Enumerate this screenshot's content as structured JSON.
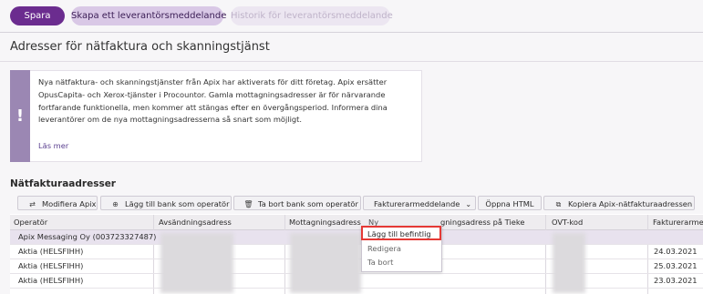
{
  "toolbar": {
    "save_label": "Spara",
    "create_message_label": "Skapa ett leverantörsmeddelande",
    "history_label": "Historik för leverantörsmeddelande"
  },
  "page": {
    "title": "Adresser för nätfaktura och skanningstjänst"
  },
  "notice": {
    "icon": "exclamation-icon",
    "text": "Nya nätfaktura- och skanningstjänster från Apix har aktiverats för ditt företag. Apix ersätter OpusCapita- och Xerox-tjänster i Procountor. Gamla mottagningsadresser är för närvarande fortfarande funktionella, men kommer att stängas efter en övergångsperiod. Informera dina leverantörer om de nya mottagningsadresserna så snart som möjligt.",
    "link_label": "Läs mer"
  },
  "section": {
    "title": "Nätfakturaadresser"
  },
  "actions": {
    "modify_apix": "Modifiera Apix",
    "add_bank": "Lägg till bank som operatör",
    "remove_bank": "Ta bort bank som operatör",
    "invoicer_message": "Fakturerarmeddelande",
    "open_html": "Öppna HTML",
    "copy_apix": "Kopiera Apix-nätfakturaadressen"
  },
  "table": {
    "headers": {
      "operator": "Operatör",
      "sender_address": "Avsändningsadress",
      "receiver_address": "Mottagningsadress",
      "tieke_address": "gningsadress på Tieke",
      "ovt": "OVT-kod",
      "invoicer": "Fakturerarme"
    },
    "rows": [
      {
        "operator": "Apix Messaging Oy (003723327487)",
        "date": ""
      },
      {
        "operator": "Aktia (HELSFIHH)",
        "date": "24.03.2021"
      },
      {
        "operator": "Aktia (HELSFIHH)",
        "date": "25.03.2021"
      },
      {
        "operator": "Aktia (HELSFIHH)",
        "date": "23.03.2021"
      }
    ]
  },
  "dropdown": {
    "items": [
      "Ny",
      "Lägg till befintlig",
      "Redigera",
      "Ta bort"
    ]
  },
  "colors": {
    "brand": "#6b2c8f",
    "brand_light": "#d9c8e6",
    "notice_stripe": "#9b87b3",
    "highlight": "#e53935"
  }
}
